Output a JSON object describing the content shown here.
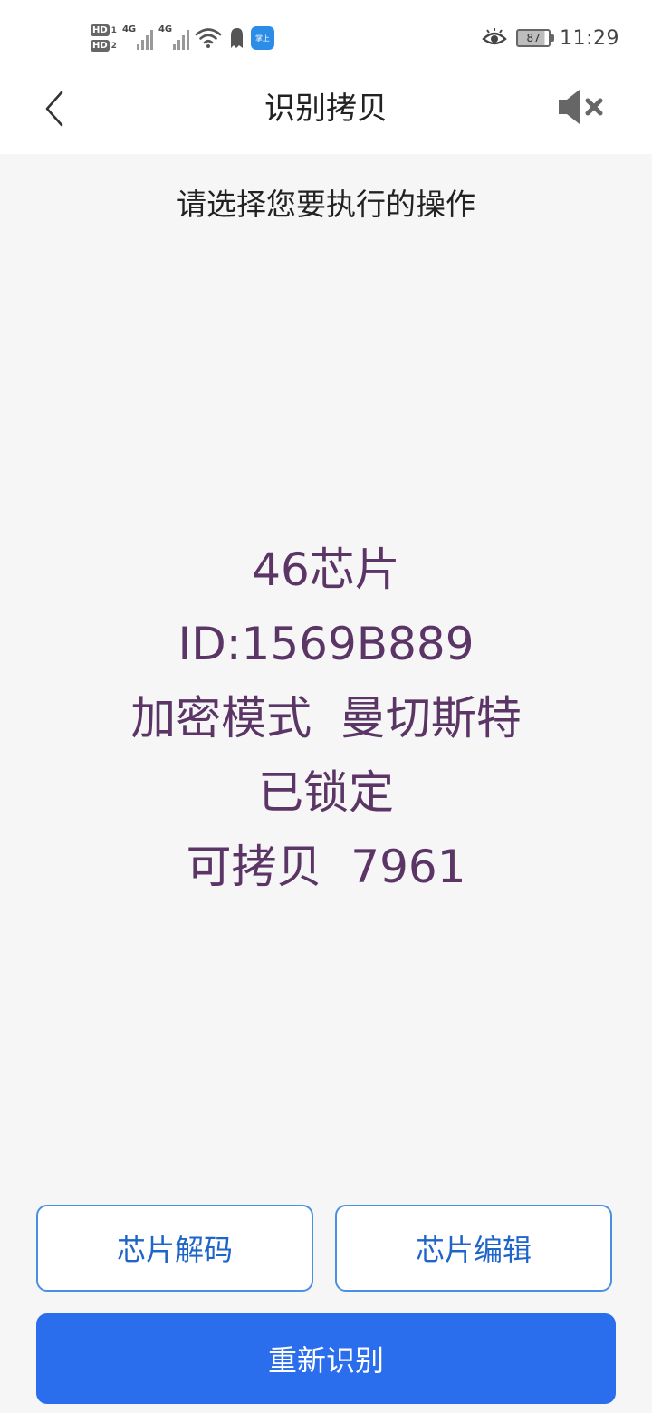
{
  "status_bar": {
    "hd_1": "HD",
    "hd_1_sub": "1",
    "hd_2": "HD",
    "hd_2_sub": "2",
    "net_1": "4G",
    "net_2": "4G",
    "app_badge_text": "掌上",
    "battery_level": "87",
    "time": "11:29"
  },
  "nav": {
    "title": "识别拷贝",
    "back_icon": "chevron-left-icon",
    "mute_icon": "speaker-muted-icon"
  },
  "content": {
    "prompt": "请选择您要执行的操作",
    "chip_info": {
      "line1": "46芯片",
      "line2": "ID:1569B889",
      "line3": "加密模式  曼切斯特",
      "line4": "已锁定",
      "line5": "可拷贝  7961"
    }
  },
  "buttons": {
    "decode": "芯片解码",
    "edit": "芯片编辑",
    "rescan": "重新识别"
  },
  "colors": {
    "accent": "#2a6ded",
    "outline": "#4a90e2",
    "info_text": "#5b3565",
    "background": "#f6f6f7"
  }
}
